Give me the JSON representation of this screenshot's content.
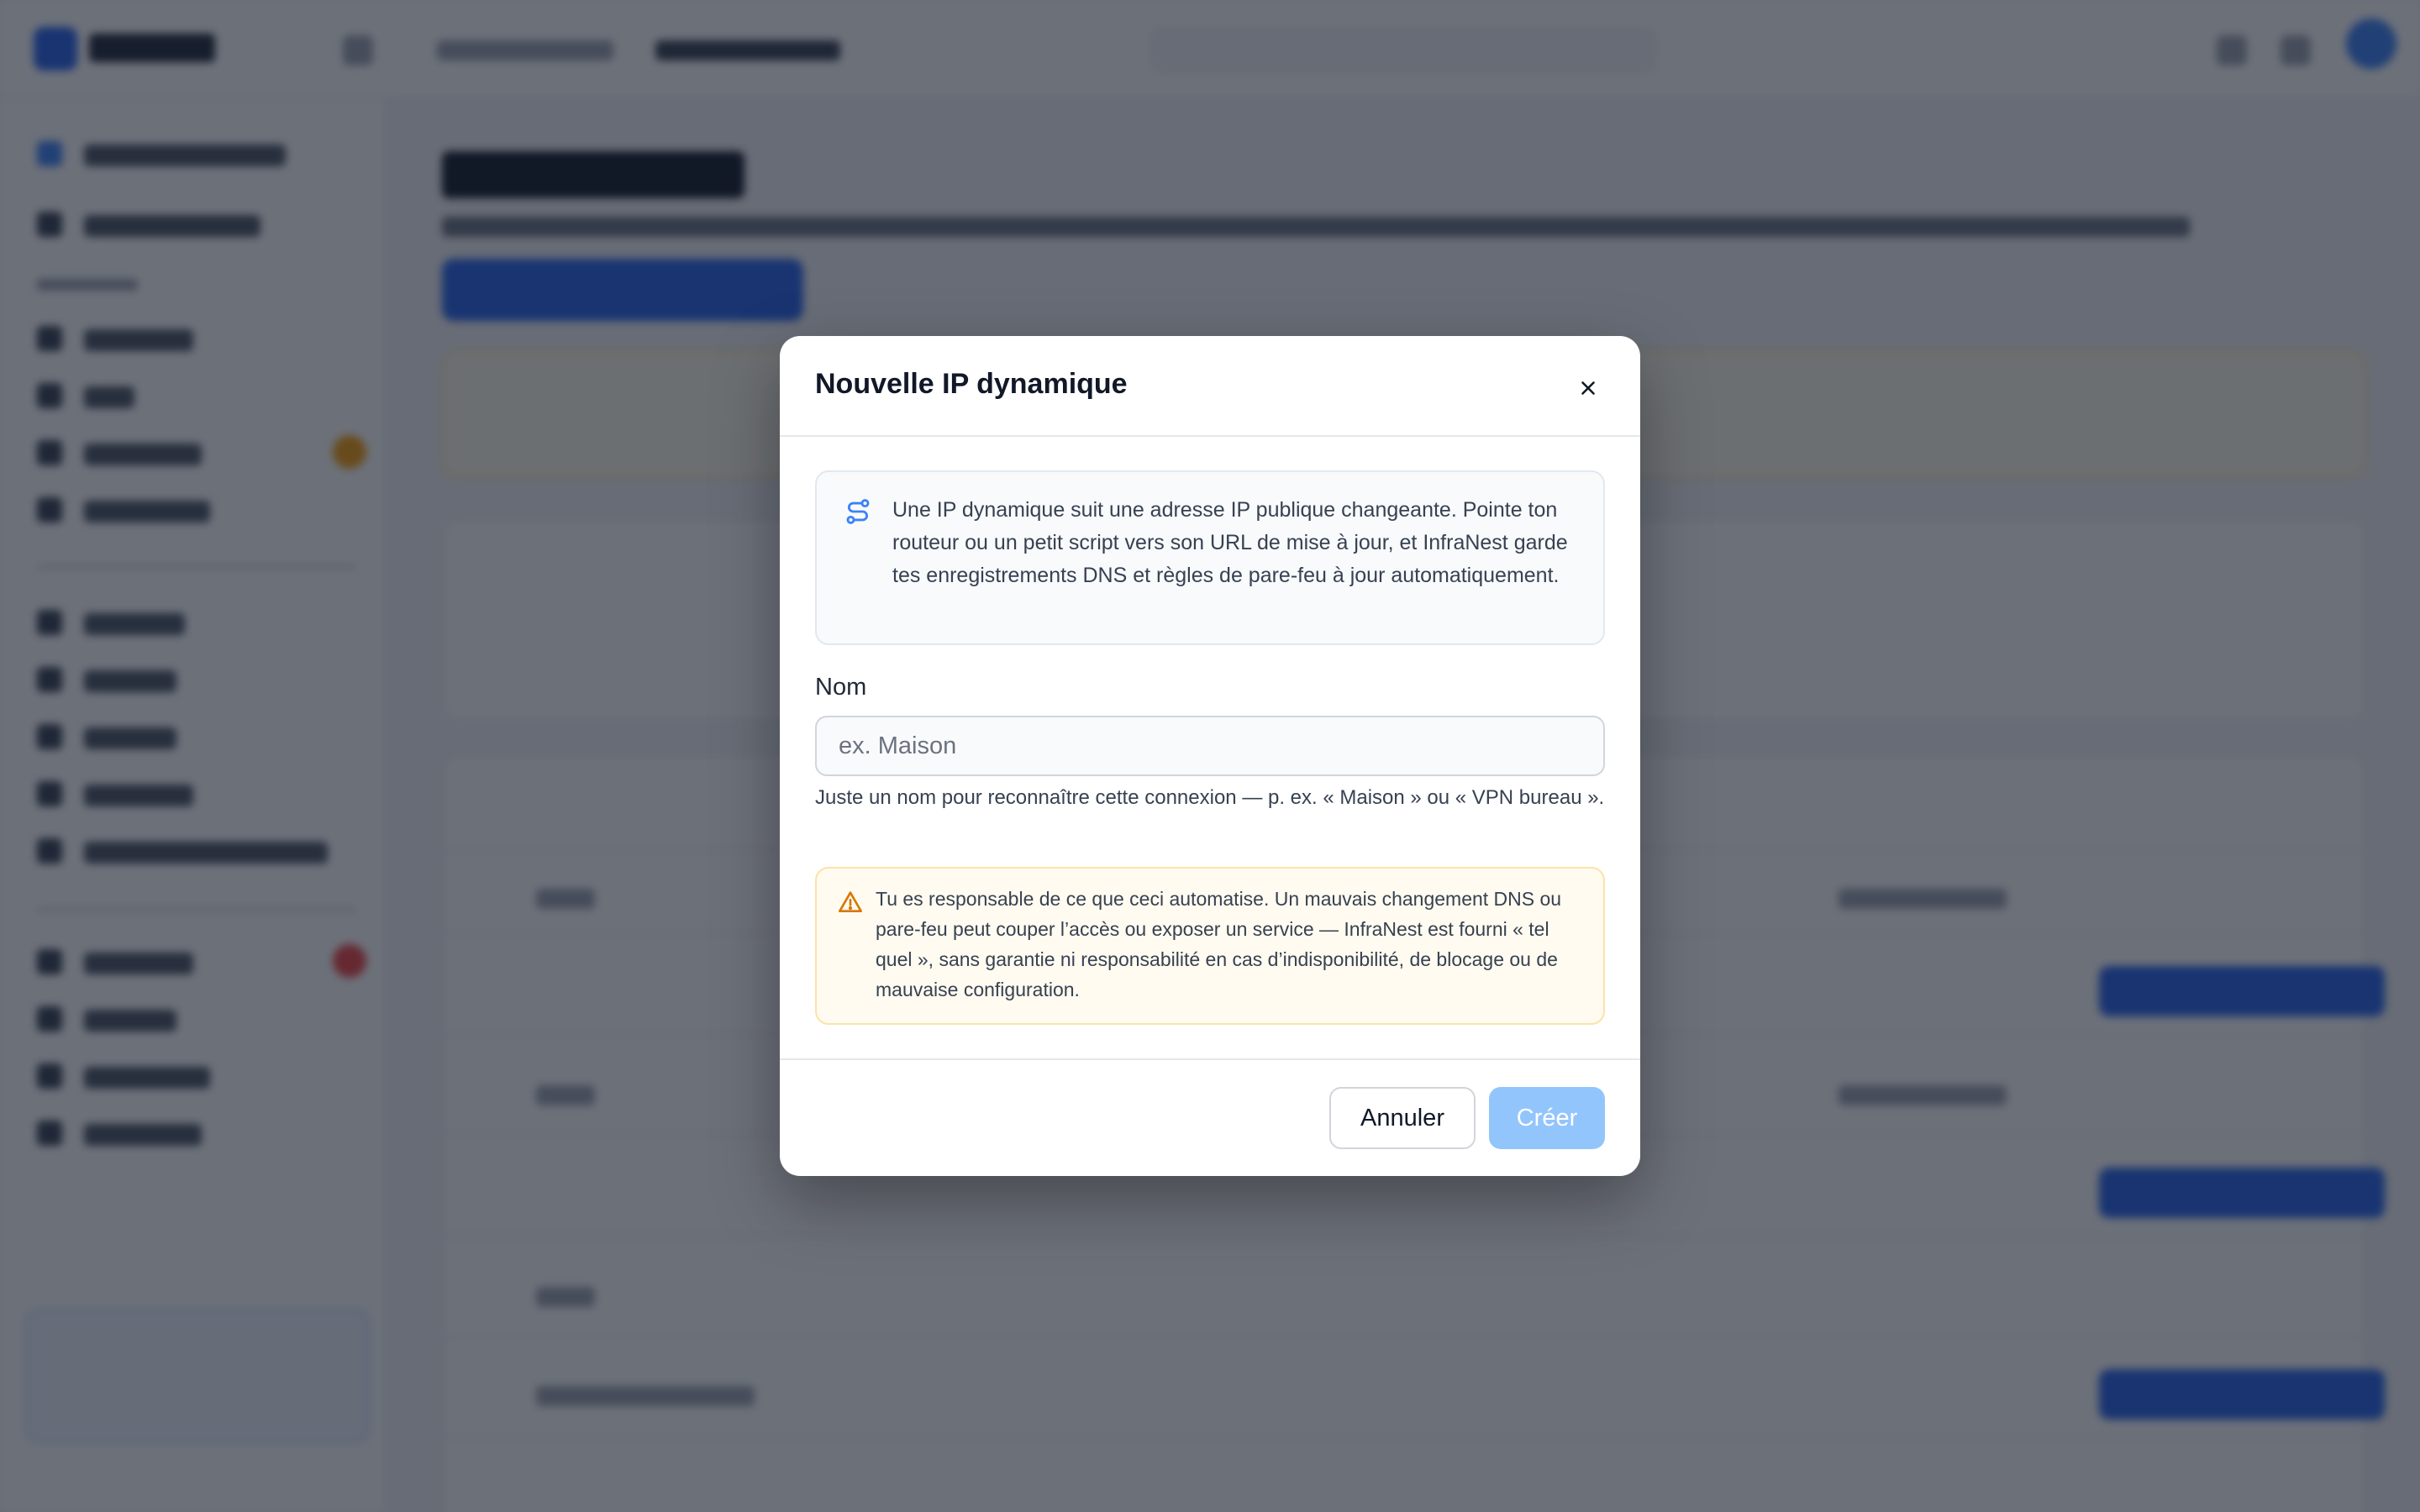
{
  "modal": {
    "title": "Nouvelle IP dynamique",
    "close_icon": "close-icon",
    "info": {
      "icon": "route-icon",
      "text": "Une IP dynamique suit une adresse IP publique changeante. Pointe ton routeur ou un petit script vers son URL de mise à jour, et InfraNest garde tes enregistrements DNS et règles de pare-feu à jour automatiquement."
    },
    "name_field": {
      "label": "Nom",
      "value": "",
      "placeholder": "ex. Maison",
      "help": "Juste un nom pour reconnaître cette connexion — p. ex. « Maison » ou « VPN bureau »."
    },
    "warning": {
      "icon": "warning-icon",
      "text": "Tu es responsable de ce que ceci automatise. Un mauvais changement DNS ou pare-feu peut couper l’accès ou exposer un service — InfraNest est fourni « tel quel », sans garantie ni responsabilité en cas d’indisponibilité, de blocage ou de mauvaise configuration."
    },
    "footer": {
      "cancel_label": "Annuler",
      "create_label": "Créer"
    }
  },
  "colors": {
    "accent": "#2563eb",
    "accent_disabled": "#93c5fd",
    "warning_bg": "#fffbf0",
    "warning_border": "#fde2a8",
    "warning_icon": "#d97706",
    "info_icon": "#3b82f6",
    "overlay": "#111827"
  }
}
